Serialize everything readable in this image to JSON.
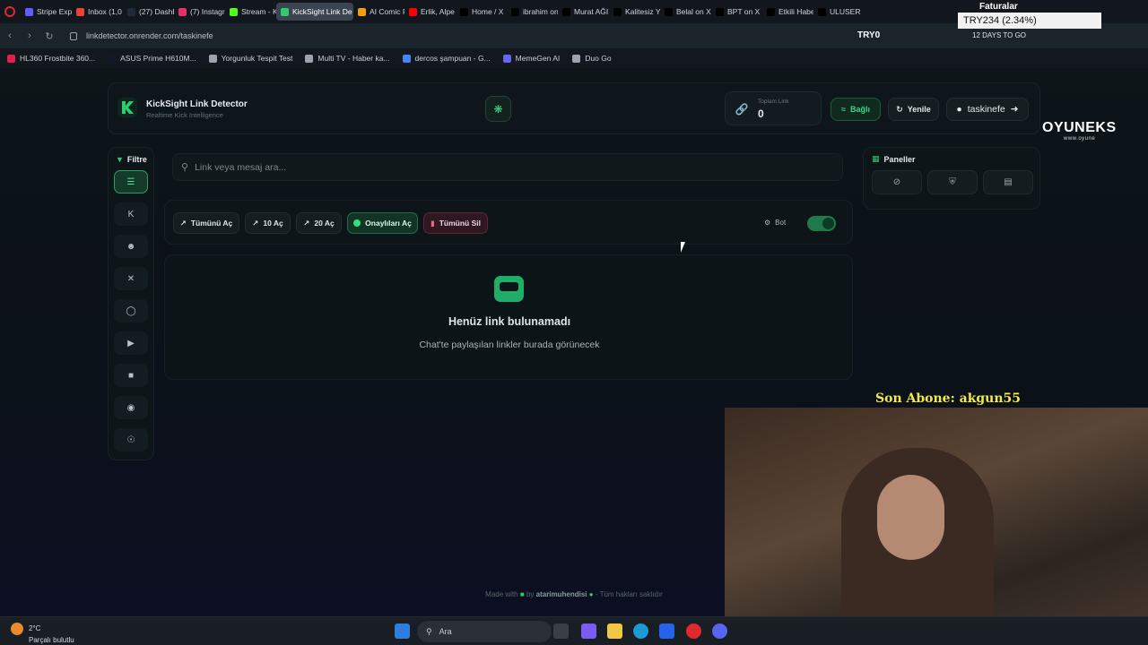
{
  "browser": {
    "tabs": [
      {
        "label": "Stripe Exp",
        "color": "#635bff"
      },
      {
        "label": "Inbox (1,0",
        "color": "#ea4335"
      },
      {
        "label": "(27) Dashb",
        "color": "#1f2937"
      },
      {
        "label": "(7) Instagr",
        "color": "#e1306c"
      },
      {
        "label": "Stream - K",
        "color": "#53fc18"
      },
      {
        "label": "KickSight Link De",
        "color": "#2ecc71",
        "active": true
      },
      {
        "label": "AI Comic F",
        "color": "#f59e0b"
      },
      {
        "label": "Erlik, Alpe",
        "color": "#ff0000"
      },
      {
        "label": "Home / X",
        "color": "#000000"
      },
      {
        "label": "ibrahim on",
        "color": "#000000"
      },
      {
        "label": "Murat AĞI",
        "color": "#000000"
      },
      {
        "label": "Kalitesiz Y",
        "color": "#000000"
      },
      {
        "label": "Belal on X",
        "color": "#000000"
      },
      {
        "label": "BPT on X",
        "color": "#000000"
      },
      {
        "label": "Etkili Habe",
        "color": "#000000"
      },
      {
        "label": "ULUSER",
        "color": "#000000"
      }
    ],
    "url": "linkdetector.onrender.com/taskinefe",
    "bookmarks": [
      {
        "label": "HL360 Frostbite 360...",
        "color": "#e11d48"
      },
      {
        "label": "ASUS Prime H610M...",
        "color": "#111827"
      },
      {
        "label": "Yorgunluk Tespit Test",
        "color": "#9ca3af"
      },
      {
        "label": "Multi TV - Haber ka...",
        "color": "#9ca3af"
      },
      {
        "label": "dercos şampuan - G...",
        "color": "#4285f4"
      },
      {
        "label": "MemeGen AI",
        "color": "#6366f1"
      },
      {
        "label": "Duo Go",
        "color": "#9ca3af"
      }
    ]
  },
  "app": {
    "brand_title": "KickSight Link Detector",
    "brand_subtitle": "Realtime Kick Intelligence",
    "total_links_label": "Toplam Link",
    "total_links_value": "0",
    "connected_label": "Bağlı",
    "refresh_label": "Yenile",
    "username": "taskinefe",
    "filter_label": "Filtre",
    "search_placeholder": "Link veya mesaj ara...",
    "actions": {
      "open_all": "Tümünü Aç",
      "open_10": "10 Aç",
      "open_20": "20 Aç",
      "open_approved": "Onaylıları Aç",
      "delete_all": "Tümünü Sil",
      "bot": "Bot"
    },
    "empty_title": "Henüz link bulunamadı",
    "empty_subtitle": "Chat'te paylaşılan linkler burada görünecek",
    "panels_label": "Paneller",
    "footer": {
      "made_with": "Made with",
      "by": "by",
      "author": "atarimuhendisi",
      "rights": "- Tüm hakları saklıdır"
    },
    "accent_color": "#2ecc71"
  },
  "overlay": {
    "faturalar": "Faturalar",
    "ticker": "TRY234 (2.34%)",
    "try0": "TRY0",
    "days": "12 DAYS TO GO",
    "oyuneks": "OYUNEKS",
    "oyuneks_url": "www.oyune",
    "son_abone": "Son Abone: akgun55"
  },
  "taskbar": {
    "temp": "2°C",
    "weather": "Parçalı bulutlu",
    "search": "Ara"
  }
}
